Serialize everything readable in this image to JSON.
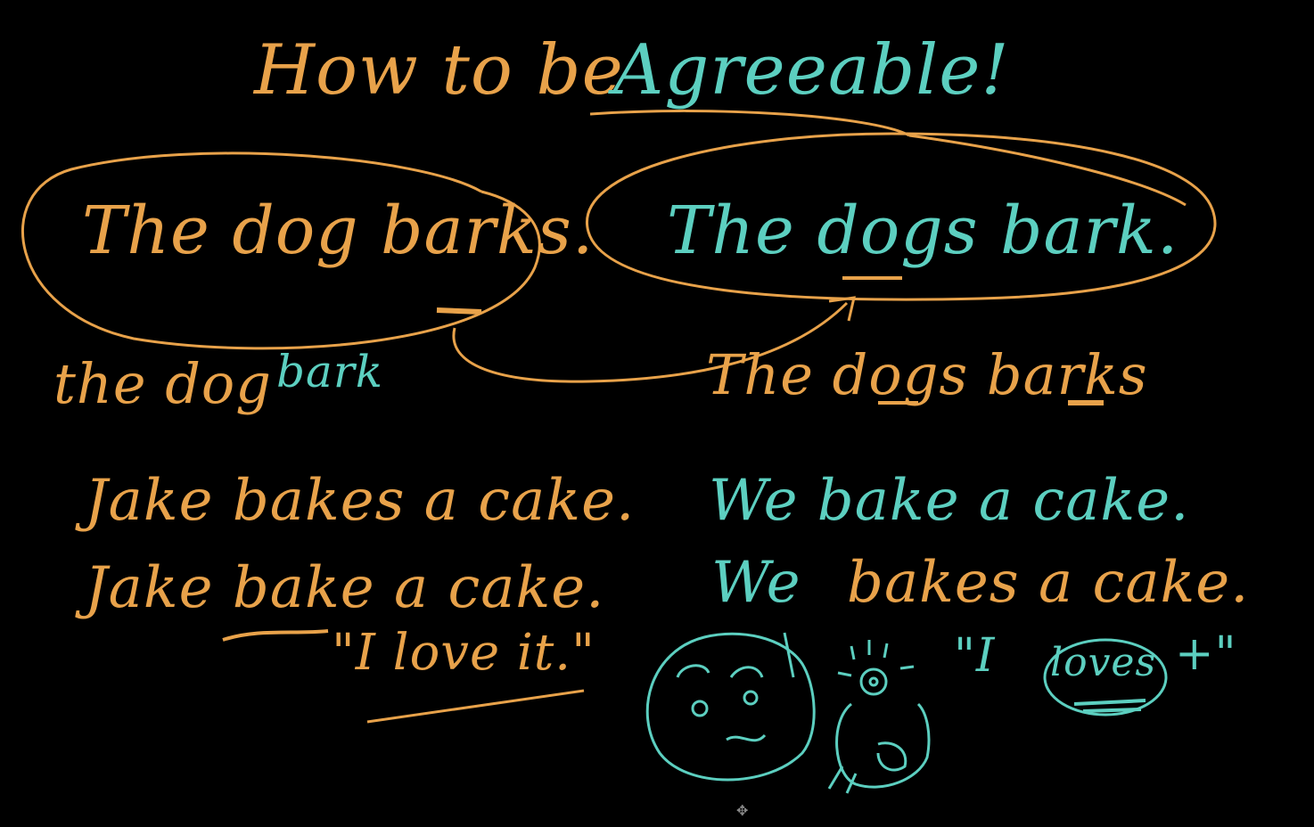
{
  "title": {
    "part1": "How to be",
    "part2": "Agreeable!"
  },
  "sentences": {
    "dog_barks": "The dog barks.",
    "dogs_bark": "The dogs bark.",
    "dog_bark": "the dog",
    "dog_bark_verb": "bark",
    "dogs_barks": "The dogs barks",
    "jake_bakes": "Jake bakes a cake.",
    "we_bake": "We bake a cake.",
    "jake_bake": "Jake bake a cake.",
    "we_bakes_subject": "We",
    "we_bakes_rest": "bakes a cake.",
    "i_love_it": "\"I love it.\"",
    "i_loves_open": "\"I",
    "i_loves_word": "loves",
    "i_loves_close": "+\""
  },
  "colors": {
    "orange": "#E8A24A",
    "teal": "#5CCFC0",
    "background": "#000000"
  },
  "icons": {
    "face": "face-doodle-icon",
    "creature": "creature-doodle-icon",
    "cursor": "move-cursor-icon"
  }
}
